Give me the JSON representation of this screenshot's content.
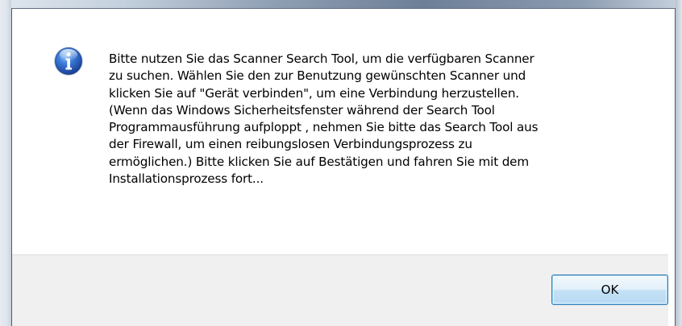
{
  "dialog": {
    "message": "Bitte nutzen Sie das Scanner Search Tool,  um die verfügbaren Scanner\nzu suchen. Wählen Sie den zur Benutzung gewünschten Scanner und\nklicken Sie auf \"Gerät verbinden\",  um eine Verbindung herzustellen.\n(Wenn das Windows Sicherheitsfenster während der Search Tool\nProgrammausführung aufploppt , nehmen Sie bitte das Search Tool aus\nder Firewall, um einen reibungslosen Verbindungsprozess zu\nermöglichen.) Bitte klicken Sie auf Bestätigen und fahren Sie mit dem\nInstallationsprozess fort...",
    "icon": "information-icon",
    "ok_label": "OK"
  },
  "colors": {
    "icon_blue": "#2a5fc0",
    "button_border": "#3c7fb1",
    "footer_bg": "#f0f0f0"
  }
}
